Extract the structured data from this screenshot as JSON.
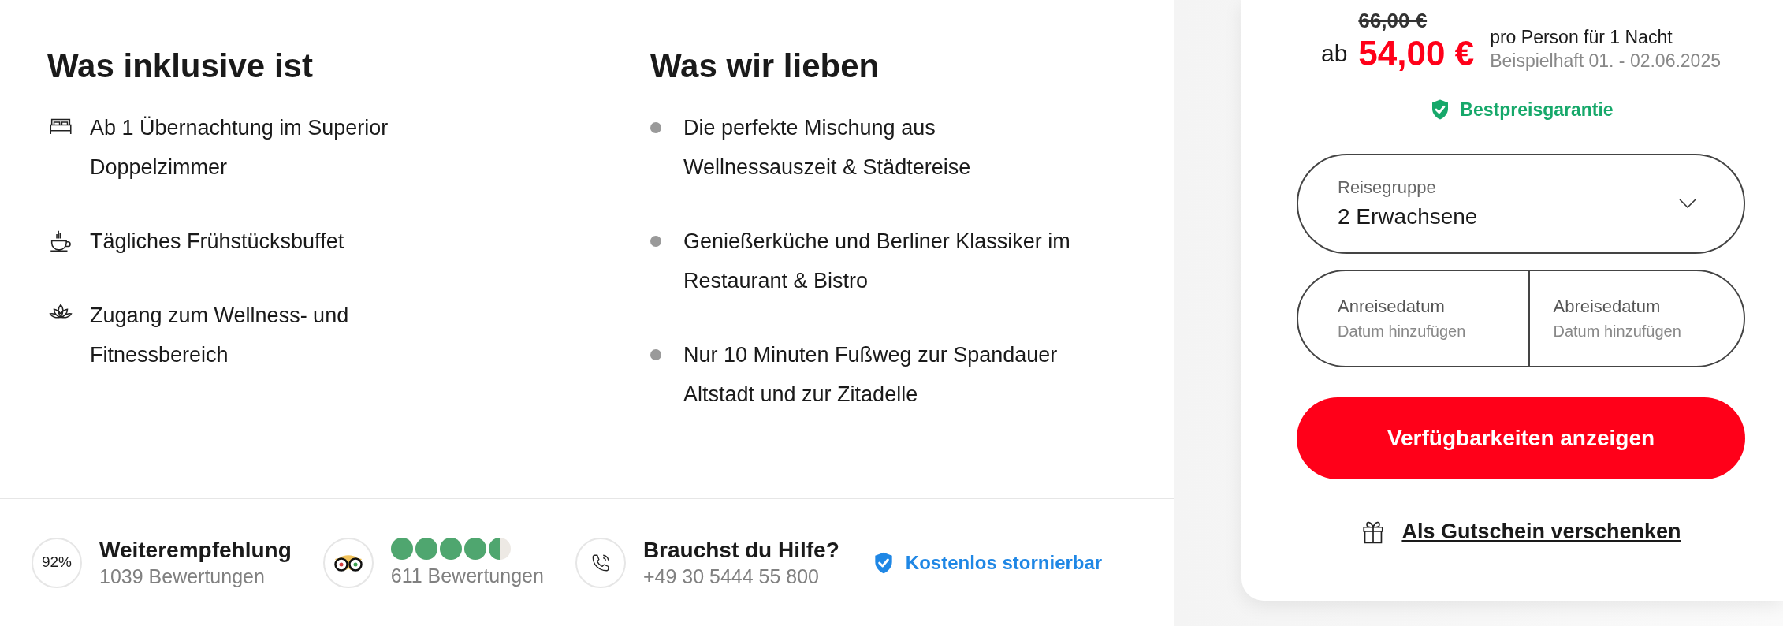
{
  "included": {
    "title": "Was inklusive ist",
    "items": [
      {
        "kind": "bed",
        "text": "Ab 1 Übernachtung im Superior Doppelzimmer"
      },
      {
        "kind": "cup",
        "text": "Tägliches Frühstücksbuffet"
      },
      {
        "kind": "lotus",
        "text": "Zugang zum Wellness- und Fitnessbereich"
      }
    ]
  },
  "loved": {
    "title": "Was wir lieben",
    "items": [
      "Die perfekte Mischung aus Wellnessauszeit & Städtereise",
      "Genießerküche und Berliner Klassiker im Restaurant & Bistro",
      "Nur 10 Minuten Fußweg zur Spandauer Altstadt und zur Zitadelle"
    ]
  },
  "footer": {
    "recommendation": {
      "badge": "92%",
      "title": "Weiterempfehlung",
      "subtitle": "1039 Bewertungen"
    },
    "tripadvisor": {
      "stars": 4.5,
      "subtitle": "611 Bewertungen"
    },
    "help": {
      "title": "Brauchst du Hilfe?",
      "phone": "+49 30 5444 55 800"
    },
    "cancellation": {
      "label": "Kostenlos stornierbar"
    }
  },
  "booking": {
    "old_price": "66,00 €",
    "prefix": "ab",
    "price": "54,00 €",
    "per": "pro Person für 1 Nacht",
    "example": "Beispielhaft 01. - 02.06.2025",
    "guarantee": "Bestpreisgarantie",
    "group": {
      "label": "Reisegruppe",
      "value": "2 Erwachsene"
    },
    "dates": [
      {
        "label": "Anreisedatum",
        "placeholder": "Datum hinzufügen"
      },
      {
        "label": "Abreisedatum",
        "placeholder": "Datum hinzufügen"
      }
    ],
    "button": "Verfügbarkeiten anzeigen",
    "voucher": "Als Gutschein verschenken"
  }
}
